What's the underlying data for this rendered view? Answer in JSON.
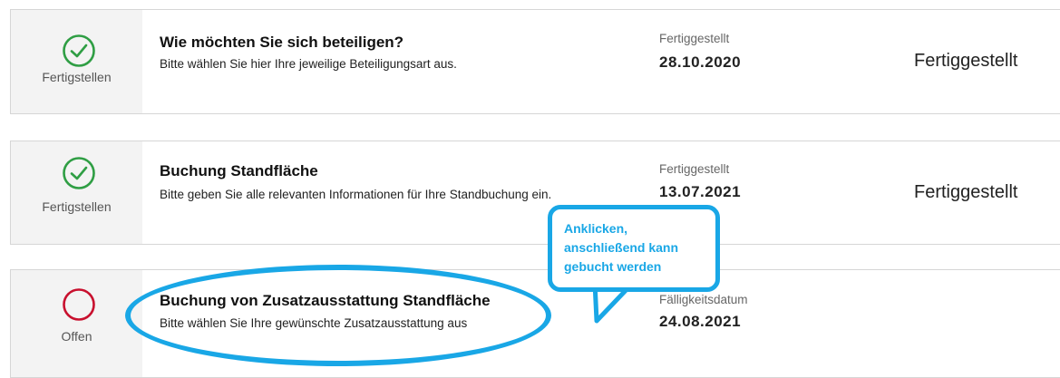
{
  "colors": {
    "done": "#2f9e44",
    "open": "#c8102e",
    "highlight": "#19a7e6"
  },
  "cards": [
    {
      "status_label": "Fertigstellen",
      "status_icon": "check-circle-icon",
      "title": "Wie möchten Sie sich beteiligen?",
      "description": "Bitte wählen Sie hier Ihre jeweilige Beteiligungsart aus.",
      "date_label": "Fertiggestellt",
      "date_value": "28.10.2020",
      "status_text": "Fertiggestellt"
    },
    {
      "status_label": "Fertigstellen",
      "status_icon": "check-circle-icon",
      "title": "Buchung Standfläche",
      "description": "Bitte geben Sie alle relevanten Informationen für Ihre Standbuchung ein.",
      "date_label": "Fertiggestellt",
      "date_value": "13.07.2021",
      "status_text": "Fertiggestellt"
    },
    {
      "status_label": "Offen",
      "status_icon": "open-circle-icon",
      "title": "Buchung von Zusatzausstattung Standfläche",
      "description": "Bitte wählen Sie Ihre gewünschte Zusatzausstattung aus",
      "date_label": "Fälligkeitsdatum",
      "date_value": "24.08.2021",
      "status_text": ""
    }
  ],
  "callout": {
    "lines": [
      "Anklicken,",
      "anschließend kann",
      "gebucht werden"
    ]
  }
}
